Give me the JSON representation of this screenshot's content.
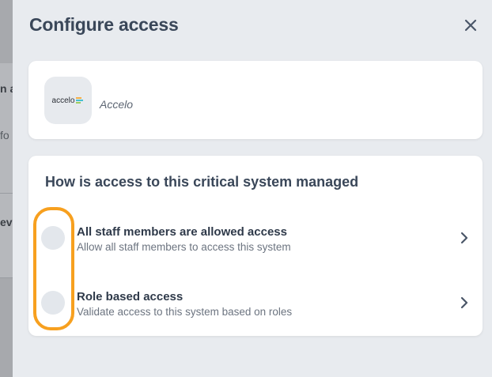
{
  "backdrop": {
    "line1": "n a",
    "line2": "fo",
    "line3": "evi"
  },
  "drawer": {
    "title": "Configure access",
    "close_icon": "close-icon"
  },
  "app": {
    "logo_text": "accelo",
    "name": "Accelo"
  },
  "question": {
    "text": "How is access to this critical system managed",
    "options": [
      {
        "title": "All staff members are allowed access",
        "description": "Allow all staff members to access this system",
        "selected": false
      },
      {
        "title": "Role based access",
        "description": "Validate access to this system based on roles",
        "selected": false
      }
    ]
  },
  "colors": {
    "highlight": "#f7a01f",
    "title": "#3a4759",
    "drawer_bg": "#e8ebef"
  }
}
